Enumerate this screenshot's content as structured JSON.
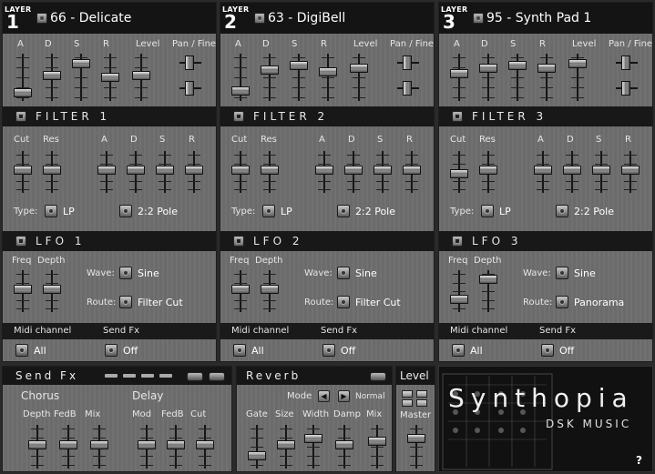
{
  "layers": [
    {
      "tag": "LAYER",
      "num": "1",
      "preset": "66 - Delicate",
      "env_labels": [
        "A",
        "D",
        "S",
        "R",
        "Level",
        "Pan / Fine"
      ],
      "env_levels": [
        0.1,
        0.55,
        0.85,
        0.5,
        0.55
      ],
      "pan_positions": [
        0.45,
        0.45
      ],
      "filter_title": "FILTER 1",
      "filter_labels": [
        "Cut",
        "Res",
        "A",
        "D",
        "S",
        "R"
      ],
      "filter_levels": [
        0.55,
        0.55,
        0.55,
        0.55,
        0.55,
        0.55
      ],
      "type_label": "Type:",
      "type_value": "LP",
      "pole_value": "2:2 Pole",
      "lfo_title": "LFO 1",
      "lfo_labels": [
        "Freq",
        "Depth"
      ],
      "lfo_levels": [
        0.55,
        0.55
      ],
      "wave_label": "Wave:",
      "wave_value": "Sine",
      "route_label": "Route:",
      "route_value": "Filter Cut",
      "midi_label": "Midi channel",
      "sendfx_label": "Send Fx",
      "midi_value": "All",
      "sendfx_value": "Off"
    },
    {
      "tag": "LAYER",
      "num": "2",
      "preset": "63 - DigiBell",
      "env_labels": [
        "A",
        "D",
        "S",
        "R",
        "Level",
        "Pan / Fine"
      ],
      "env_levels": [
        0.15,
        0.7,
        0.8,
        0.65,
        0.75
      ],
      "pan_positions": [
        0.45,
        0.45
      ],
      "filter_title": "FILTER 2",
      "filter_labels": [
        "Cut",
        "Res",
        "A",
        "D",
        "S",
        "R"
      ],
      "filter_levels": [
        0.55,
        0.55,
        0.55,
        0.55,
        0.55,
        0.55
      ],
      "type_label": "Type:",
      "type_value": "LP",
      "pole_value": "2:2 Pole",
      "lfo_title": "LFO 2",
      "lfo_labels": [
        "Freq",
        "Depth"
      ],
      "lfo_levels": [
        0.55,
        0.55
      ],
      "wave_label": "Wave:",
      "wave_value": "Sine",
      "route_label": "Route:",
      "route_value": "Filter Cut",
      "midi_label": "Midi channel",
      "sendfx_label": "Send Fx",
      "midi_value": "All",
      "sendfx_value": "Off"
    },
    {
      "tag": "LAYER",
      "num": "3",
      "preset": "95 - Synth Pad 1",
      "env_labels": [
        "A",
        "D",
        "S",
        "R",
        "Level",
        "Pan / Fine"
      ],
      "env_levels": [
        0.6,
        0.75,
        0.8,
        0.75,
        0.85
      ],
      "pan_positions": [
        0.45,
        0.45
      ],
      "filter_title": "FILTER 3",
      "filter_labels": [
        "Cut",
        "Res",
        "A",
        "D",
        "S",
        "R"
      ],
      "filter_levels": [
        0.45,
        0.55,
        0.55,
        0.55,
        0.55,
        0.55
      ],
      "type_label": "Type:",
      "type_value": "LP",
      "pole_value": "2:2 Pole",
      "lfo_title": "LFO 3",
      "lfo_labels": [
        "Freq",
        "Depth"
      ],
      "lfo_levels": [
        0.25,
        0.85
      ],
      "wave_label": "Wave:",
      "wave_value": "Sine",
      "route_label": "Route:",
      "route_value": "Panorama",
      "midi_label": "Midi channel",
      "sendfx_label": "Send Fx",
      "midi_value": "All",
      "sendfx_value": "Off"
    }
  ],
  "sendfx": {
    "title": "Send Fx",
    "chorus_title": "Chorus",
    "delay_title": "Delay",
    "labels": [
      "Depth",
      "FedB",
      "Mix",
      "Mod",
      "FedB",
      "Cut"
    ],
    "levels": [
      0.55,
      0.55,
      0.55,
      0.55,
      0.55,
      0.55
    ]
  },
  "reverb": {
    "title": "Reverb",
    "mode_label": "Mode",
    "mode_value": "Normal",
    "labels": [
      "Gate",
      "Size",
      "Width",
      "Damp",
      "Mix"
    ],
    "levels": [
      0.25,
      0.55,
      0.75,
      0.55,
      0.65
    ]
  },
  "level": {
    "title": "Level",
    "master_label": "Master",
    "master_level": 0.75
  },
  "branding": {
    "name": "Synthopia",
    "sub": "DSK MUSIC",
    "help": "?"
  },
  "colors": {
    "panel": "#6e6e6e",
    "header": "#141414",
    "text": "#e6e6e6"
  }
}
